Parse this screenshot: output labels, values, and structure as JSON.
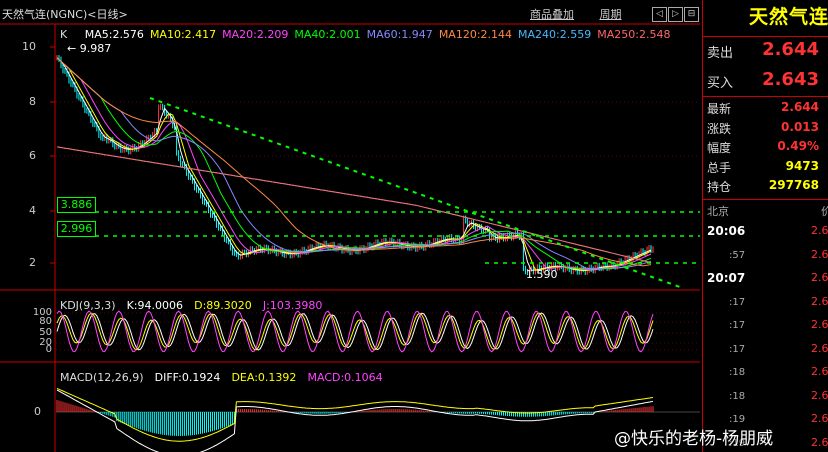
{
  "chart": {
    "title": "天然气连(NGNC)<日线>",
    "buttons": [
      "商品叠加",
      "周期"
    ],
    "nav": [
      "◁",
      "▷",
      "⊟"
    ],
    "price_label": "K",
    "ma": [
      {
        "label": "MA5:2.576",
        "color": "#ffffff"
      },
      {
        "label": "MA10:2.417",
        "color": "#ffff00"
      },
      {
        "label": "MA20:2.209",
        "color": "#ff44ff"
      },
      {
        "label": "MA40:2.001",
        "color": "#00ff00"
      },
      {
        "label": "MA60:1.947",
        "color": "#8888ff"
      },
      {
        "label": "MA120:2.144",
        "color": "#ff8844"
      },
      {
        "label": "MA240:2.559",
        "color": "#44bbff"
      },
      {
        "label": "MA250:2.548",
        "color": "#ff6666"
      }
    ],
    "high_label": "9.987",
    "low_label": "1.590",
    "box_labels": [
      "3.886",
      "2.996"
    ],
    "y_ticks": [
      "10",
      "8",
      "6",
      "4",
      "2"
    ],
    "kdj": {
      "title": "KDJ(9,3,3)",
      "k": "K:94.0006",
      "d": "D:89.3020",
      "j": "J:103.3980",
      "ticks": [
        "100",
        "80",
        "50",
        "20",
        "0"
      ]
    },
    "macd": {
      "title": "MACD(12,26,9)",
      "diff": "DIFF:0.1924",
      "dea": "DEA:0.1392",
      "macd": "MACD:0.1064",
      "zero": "0"
    }
  },
  "side": {
    "name": "天然气连",
    "quotes": [
      {
        "label": "卖出",
        "value": "2.644"
      },
      {
        "label": "买入",
        "value": "2.643"
      }
    ],
    "stats": [
      {
        "label": "最新",
        "value": "2.644",
        "color": "#ff3333"
      },
      {
        "label": "涨跌",
        "value": "0.013",
        "color": "#ff3333"
      },
      {
        "label": "幅度",
        "value": "0.49%",
        "color": "#ff3333"
      },
      {
        "label": "总手",
        "value": "9473",
        "color": "#ffff00"
      },
      {
        "label": "持仓",
        "value": "297768",
        "color": "#ffff00"
      }
    ],
    "tick_header": {
      "left": "北京",
      "right": "价"
    },
    "ticks": [
      {
        "time": "20:06",
        "price": "2.6"
      },
      {
        "time": ":57",
        "price": "2.6"
      },
      {
        "time": "20:07",
        "price": "2.6"
      },
      {
        "time": ":17",
        "price": "2.6"
      },
      {
        "time": ":17",
        "price": "2.6"
      },
      {
        "time": ":17",
        "price": "2.6"
      },
      {
        "time": ":18",
        "price": "2.6"
      },
      {
        "time": ":18",
        "price": "2.6"
      },
      {
        "time": ":19",
        "price": "2.6"
      },
      {
        "time": ":19",
        "price": "2.6"
      }
    ]
  },
  "watermark": "@快乐的老杨-杨朋威"
}
